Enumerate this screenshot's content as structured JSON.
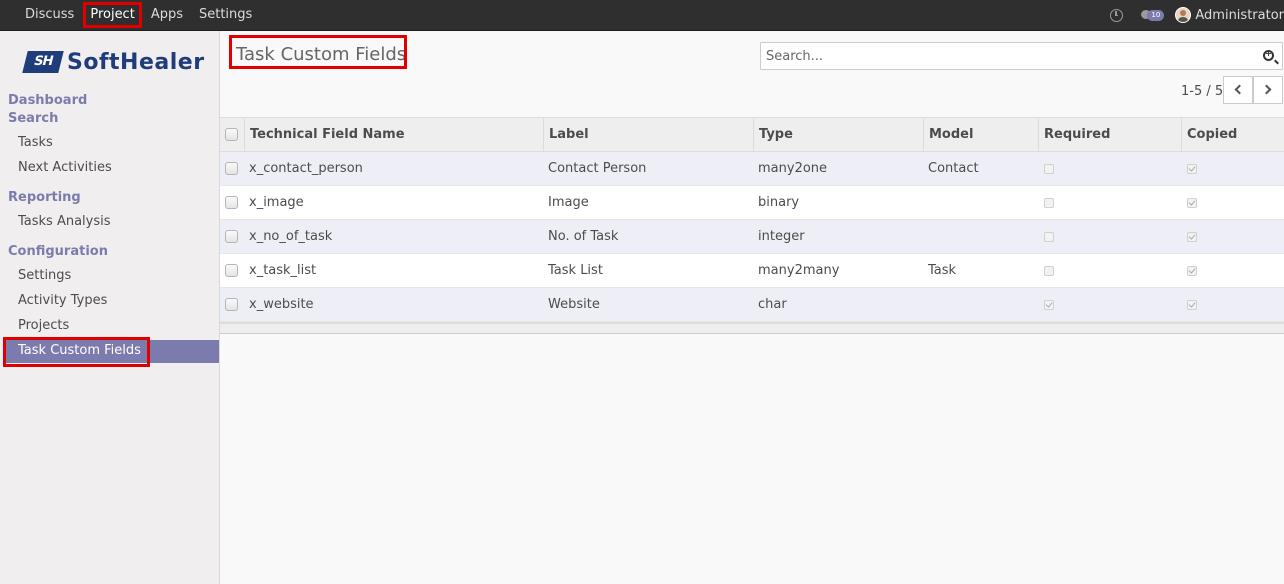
{
  "topbar": {
    "menu": [
      {
        "label": "Discuss",
        "active": false
      },
      {
        "label": "Project",
        "active": true
      },
      {
        "label": "Apps",
        "active": false
      },
      {
        "label": "Settings",
        "active": false
      }
    ],
    "activity_icon": "clock-icon",
    "messages_icon": "chat-bubble-icon",
    "messages_count": "10",
    "user_name": "Administrator"
  },
  "sidebar": {
    "logo_text": "SoftHealer",
    "logo_mark": "SH",
    "dashboard_label": "Dashboard",
    "search_label": "Search",
    "search_items": [
      "Tasks",
      "Next Activities"
    ],
    "reporting_label": "Reporting",
    "reporting_items": [
      "Tasks Analysis"
    ],
    "configuration_label": "Configuration",
    "configuration_items": [
      "Settings",
      "Activity Types",
      "Projects"
    ],
    "active_item": "Task Custom Fields"
  },
  "main": {
    "title": "Task Custom Fields",
    "search_placeholder": "Search...",
    "pager_text": "1-5 / 5",
    "columns": [
      "Technical Field Name",
      "Label",
      "Type",
      "Model",
      "Required",
      "Copied"
    ],
    "rows": [
      {
        "name": "x_contact_person",
        "label": "Contact Person",
        "type": "many2one",
        "model": "Contact",
        "required": false,
        "copied": true
      },
      {
        "name": "x_image",
        "label": "Image",
        "type": "binary",
        "model": "",
        "required": false,
        "copied": true
      },
      {
        "name": "x_no_of_task",
        "label": "No. of Task",
        "type": "integer",
        "model": "",
        "required": false,
        "copied": true
      },
      {
        "name": "x_task_list",
        "label": "Task List",
        "type": "many2many",
        "model": "Task",
        "required": false,
        "copied": true
      },
      {
        "name": "x_website",
        "label": "Website",
        "type": "char",
        "model": "",
        "required": true,
        "copied": true
      }
    ]
  },
  "colors": {
    "accent": "#7c7bad",
    "topbar": "#2f2f2f",
    "highlight": "#e00000"
  }
}
